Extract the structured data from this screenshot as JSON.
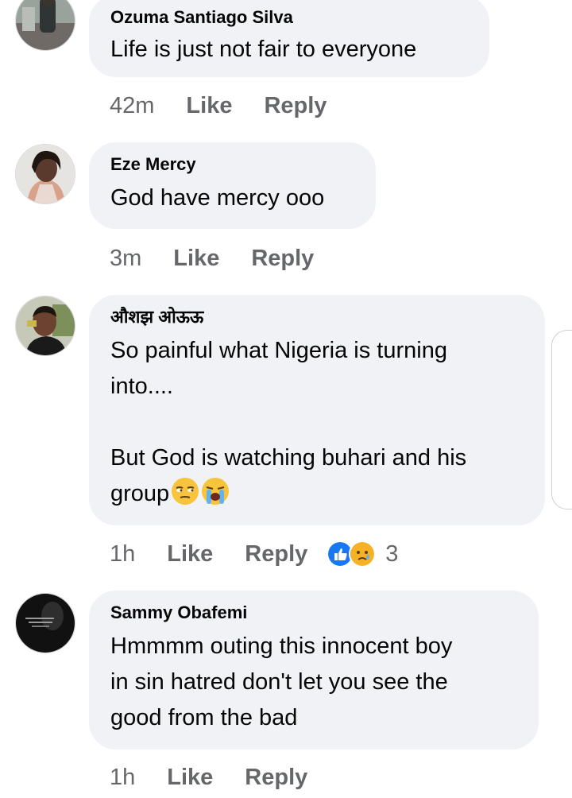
{
  "comments": [
    {
      "author": "Ozuma Santiago Silva",
      "text": "Life is just not fair to everyone",
      "time": "42m",
      "like_label": "Like",
      "reply_label": "Reply"
    },
    {
      "author": "Eze Mercy",
      "text": "God have mercy ooo",
      "time": "3m",
      "like_label": "Like",
      "reply_label": "Reply"
    },
    {
      "author": "औशझ ओऊऊ",
      "text": "So painful what Nigeria is turning\ninto....\n\nBut God is watching buhari and his\ngroup",
      "time": "1h",
      "like_label": "Like",
      "reply_label": "Reply",
      "reactions": {
        "icons": [
          "like-reaction-icon",
          "sad-reaction-icon"
        ],
        "count": "3"
      }
    },
    {
      "author": "Sammy Obafemi",
      "text": "Hmmmm outing this innocent boy\nin sin hatred don't let you see the\ngood from the bad",
      "time": "1h",
      "like_label": "Like",
      "reply_label": "Reply"
    }
  ],
  "colors": {
    "bubble": "#f0f2f5",
    "text": "#050505",
    "meta": "#65676b",
    "like_blue": "#1877f2",
    "reaction_yellow": "#f7b125"
  }
}
